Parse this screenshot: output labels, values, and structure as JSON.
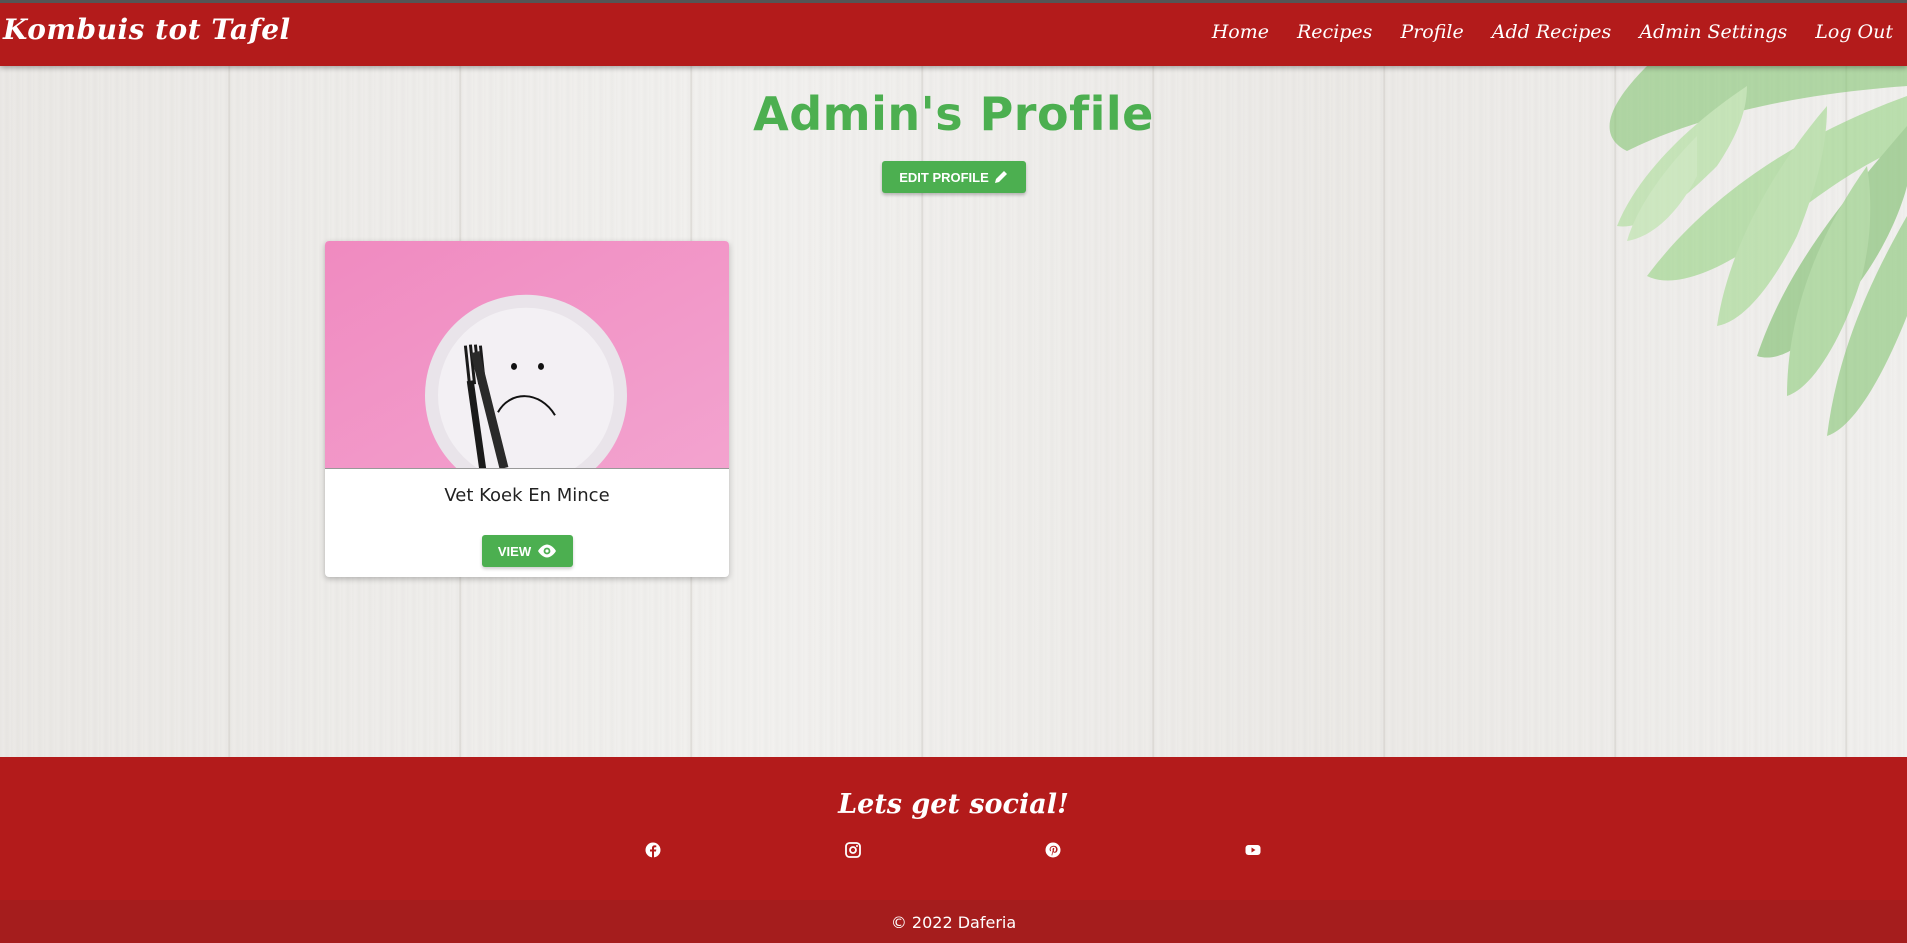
{
  "brand": "Kombuis tot Tafel",
  "nav": {
    "items": [
      {
        "label": "Home"
      },
      {
        "label": "Recipes"
      },
      {
        "label": "Profile"
      },
      {
        "label": "Add Recipes"
      },
      {
        "label": "Admin Settings"
      },
      {
        "label": "Log Out"
      }
    ]
  },
  "profile": {
    "title": "Admin's Profile",
    "edit_button": "EDIT PROFILE",
    "edit_icon": "pencil-icon"
  },
  "recipes": [
    {
      "title": "Vet Koek En Mince",
      "button": "VIEW",
      "button_icon": "eye-icon",
      "image": "sad-face-plate"
    }
  ],
  "footer": {
    "title": "Lets get social!",
    "social_icons": [
      "facebook-icon",
      "instagram-icon",
      "pinterest-icon",
      "youtube-icon"
    ],
    "copyright": "© 2022 Daferia"
  },
  "colors": {
    "primary_red": "#b31b1b",
    "accent_green": "#4caf50"
  }
}
